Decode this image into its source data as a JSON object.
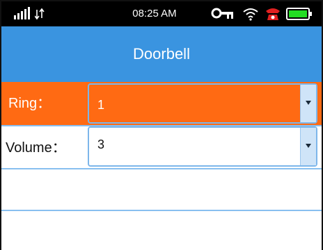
{
  "statusbar": {
    "time": "08:25 AM",
    "icons": [
      "signal-icon",
      "data-transfer-icon",
      "key-icon",
      "wifi-icon",
      "alarm-icon",
      "battery-icon"
    ]
  },
  "header": {
    "title": "Doorbell"
  },
  "settings": {
    "ring": {
      "label": "Ring：",
      "value": "1"
    },
    "volume": {
      "label": "Volume：",
      "value": "3"
    }
  },
  "colors": {
    "header": "#3a94e0",
    "selected_row": "#ff6a13",
    "divider": "#88bff0",
    "statusbar": "#000000"
  }
}
